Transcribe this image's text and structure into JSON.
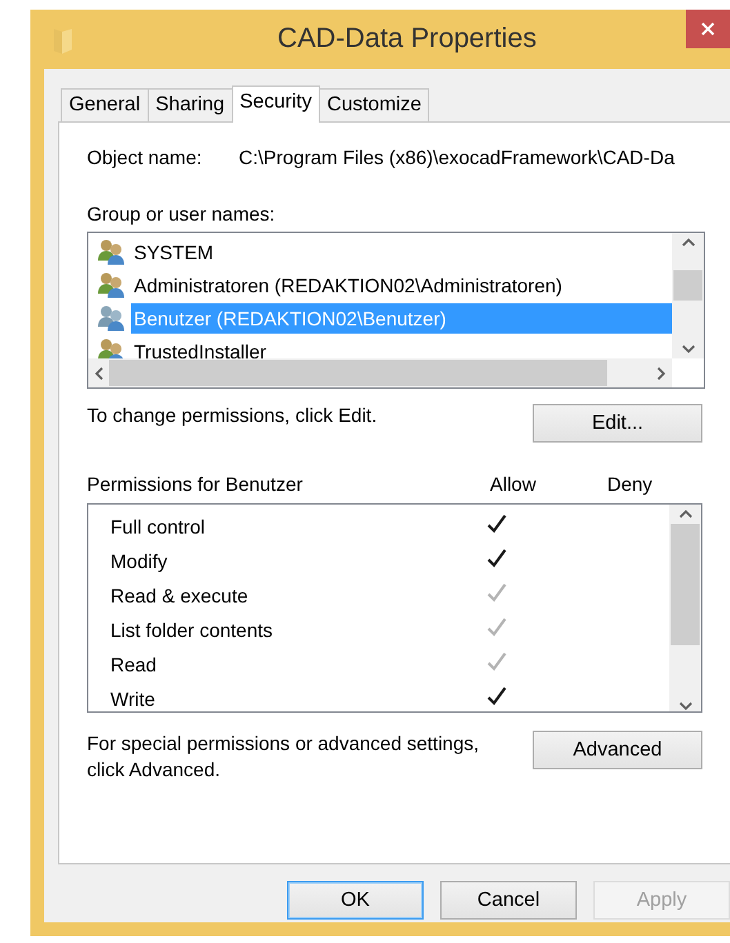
{
  "window": {
    "title": "CAD-Data Properties"
  },
  "tabs": [
    {
      "label": "General",
      "selected": false
    },
    {
      "label": "Sharing",
      "selected": false
    },
    {
      "label": "Security",
      "selected": true
    },
    {
      "label": "Customize",
      "selected": false
    }
  ],
  "object_name": {
    "label": "Object name:",
    "value": "C:\\Program Files (x86)\\exocadFramework\\CAD-Da"
  },
  "groups": {
    "label": "Group or user names:",
    "items": [
      {
        "name": "SYSTEM",
        "selected": false
      },
      {
        "name": "Administratoren (REDAKTION02\\Administratoren)",
        "selected": false
      },
      {
        "name": "Benutzer (REDAKTION02\\Benutzer)",
        "selected": true
      },
      {
        "name": "TrustedInstaller",
        "selected": false
      }
    ]
  },
  "change_hint": "To change permissions, click Edit.",
  "edit_button": "Edit...",
  "permissions": {
    "title": "Permissions for Benutzer",
    "allow_header": "Allow",
    "deny_header": "Deny",
    "rows": [
      {
        "name": "Full control",
        "allow": true,
        "inherited": false
      },
      {
        "name": "Modify",
        "allow": true,
        "inherited": false
      },
      {
        "name": "Read & execute",
        "allow": true,
        "inherited": true
      },
      {
        "name": "List folder contents",
        "allow": true,
        "inherited": true
      },
      {
        "name": "Read",
        "allow": true,
        "inherited": true
      },
      {
        "name": "Write",
        "allow": true,
        "inherited": false
      }
    ]
  },
  "advanced_hint": "For special permissions or advanced settings, click Advanced.",
  "advanced_button": "Advanced",
  "buttons": [
    {
      "label": "OK",
      "kind": "default"
    },
    {
      "label": "Cancel",
      "kind": "normal"
    },
    {
      "label": "Apply",
      "kind": "disabled"
    }
  ]
}
